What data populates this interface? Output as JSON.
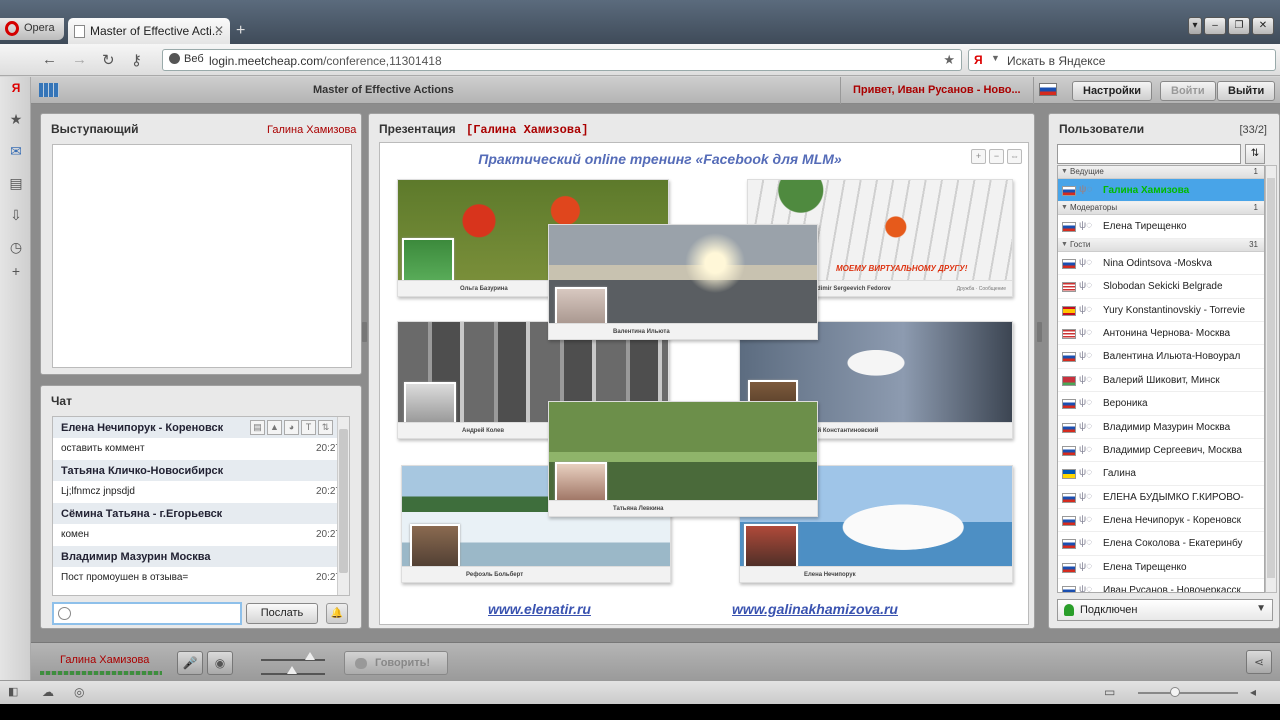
{
  "browser": {
    "menu_label": "Opera",
    "tab_title": "Master of Effective Acti...",
    "address_prefix": "Веб",
    "address_host": "login.meetcheap.com",
    "address_path": "/conference,11301418",
    "search_placeholder": "Искать в Яндексе",
    "search_engine": "Я"
  },
  "header": {
    "conference_title": "Master of Effective Actions",
    "greeting": "Привет, Иван Русанов - Ново...",
    "settings_label": "Настройки",
    "login_label": "Войти",
    "logout_label": "Выйти"
  },
  "speaker": {
    "title": "Выступающий",
    "name": "Галина  Хамизова"
  },
  "chat": {
    "title": "Чат",
    "messages": [
      {
        "author": "Елена Нечипорук - Кореновск",
        "text": "оставить коммент",
        "time": "20:27"
      },
      {
        "author": "Татьяна Кличко-Новосибирск",
        "text": "Lj;lfnmcz jnpsdjd",
        "time": "20:27"
      },
      {
        "author": "Сёмина  Татьяна  -  г.Егорьевск",
        "text": "комен",
        "time": "20:27"
      },
      {
        "author": "Владимир Мазурин Москва",
        "text": "Пост промоушен  в отзыва=",
        "time": "20:27"
      }
    ],
    "send_label": "Послать"
  },
  "presentation": {
    "title": "Презентация",
    "owner": "[Галина  Хамизова]",
    "slide": {
      "heading": "Практический online тренинг «Facebook для  MLM»",
      "red_banner": "МОЕМУ ВИРТУАЛЬНОМУ ДРУГУ!",
      "captions": [
        "Ольга Базурина",
        "Валентина Ильюта",
        "Vladimir Sergeevich Fedorov",
        "Андрей Колев",
        "Юрий Константиновский",
        "Татьяна Левкина",
        "Рефоэль Больберт",
        "Елена Нечипорук"
      ],
      "card_button_1": "Дружба",
      "card_button_2": "Сообщение",
      "url_left": "www.elenatir.ru",
      "url_right": "www.galinakhamizova.ru"
    }
  },
  "users": {
    "title": "Пользователи",
    "count": "[33/2]",
    "groups": [
      {
        "name": "Ведущие",
        "count": "1"
      },
      {
        "name": "Модераторы",
        "count": "1"
      },
      {
        "name": "Гости",
        "count": "31"
      }
    ],
    "host": {
      "name": "Галина  Хамизова",
      "flag": "ru"
    },
    "moderator": {
      "name": "Елена  Тирещенко",
      "flag": "ru"
    },
    "guests": [
      {
        "name": "Nina Odintsova -Moskva",
        "flag": "ru"
      },
      {
        "name": "Slobodan Sekicki Belgrade",
        "flag": "us"
      },
      {
        "name": "Yury Konstantinovskiy - Torrevie",
        "flag": "es"
      },
      {
        "name": "Антонина Чернова- Москва",
        "flag": "us"
      },
      {
        "name": "Валентина Ильюта-Новоурал",
        "flag": "ru"
      },
      {
        "name": "Валерий Шиковит, Минск",
        "flag": "by"
      },
      {
        "name": "Вероника",
        "flag": "ru"
      },
      {
        "name": "Владимир Мазурин Москва",
        "flag": "ru"
      },
      {
        "name": "Владимир Сергеевич, Москва",
        "flag": "ru"
      },
      {
        "name": "Галина",
        "flag": "ua"
      },
      {
        "name": "ЕЛЕНА БУДЫМКО Г.КИРОВО-",
        "flag": "ru"
      },
      {
        "name": "Елена Нечипорук - Кореновск",
        "flag": "ru"
      },
      {
        "name": "Елена Соколова - Екатеринбу",
        "flag": "ru"
      },
      {
        "name": "Елена Тирещенко",
        "flag": "ru"
      },
      {
        "name": "Иван Русанов - Новочеркасск",
        "flag": "ru"
      }
    ],
    "status": "Подключен"
  },
  "bottom": {
    "current_user": "Галина  Хамизова",
    "talk_label": "Говорить!"
  },
  "flags": {
    "ru": "linear-gradient(#fff 33%, #1a4fb0 33% 66%, #d52b1e 66%)",
    "us": "repeating-linear-gradient(#c33 0 1.5px, #fff 1.5px 3px)",
    "es": "linear-gradient(#c60b1e 25%, #ffc400 25% 75%, #c60b1e 75%)",
    "by": "linear-gradient(#c8313e 66%, #4aa657 66%)",
    "ua": "linear-gradient(#0057b7 50%, #ffd700 50%)"
  }
}
